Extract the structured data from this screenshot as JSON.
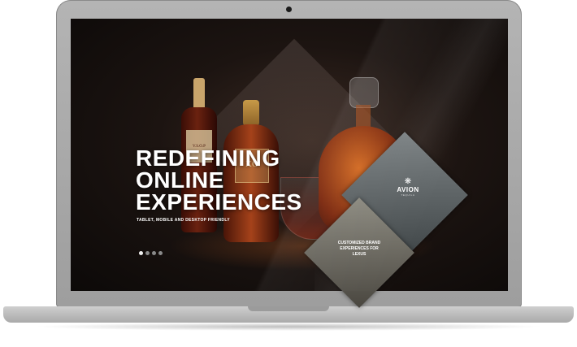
{
  "hero": {
    "title_lines": [
      "REDEFINING",
      "ONLINE",
      "EXPERIENCES"
    ],
    "subtitle": "TABLET, MOBILE AND DESKTOP FRIENDLY"
  },
  "bottles": {
    "vsop_label": "V.S.O.P",
    "xo_label": "XO"
  },
  "carousel": {
    "dot_count": 4,
    "active_index": 0
  },
  "promos": {
    "avion": {
      "name": "AVION",
      "sub": "TEQUILA"
    },
    "lexus": {
      "line1": "CUSTOMIZED BRAND",
      "line2": "EXPERIENCES FOR",
      "line3": "LEXUS"
    }
  },
  "icons": {
    "camera": "camera-icon",
    "avion_mark": "agave-icon"
  },
  "colors": {
    "screen_bg": "#1c1411",
    "frame": "#a8a8a8",
    "text": "#ffffff",
    "dot_active": "#f0f0f0",
    "dot_inactive": "#8a8a8a"
  }
}
